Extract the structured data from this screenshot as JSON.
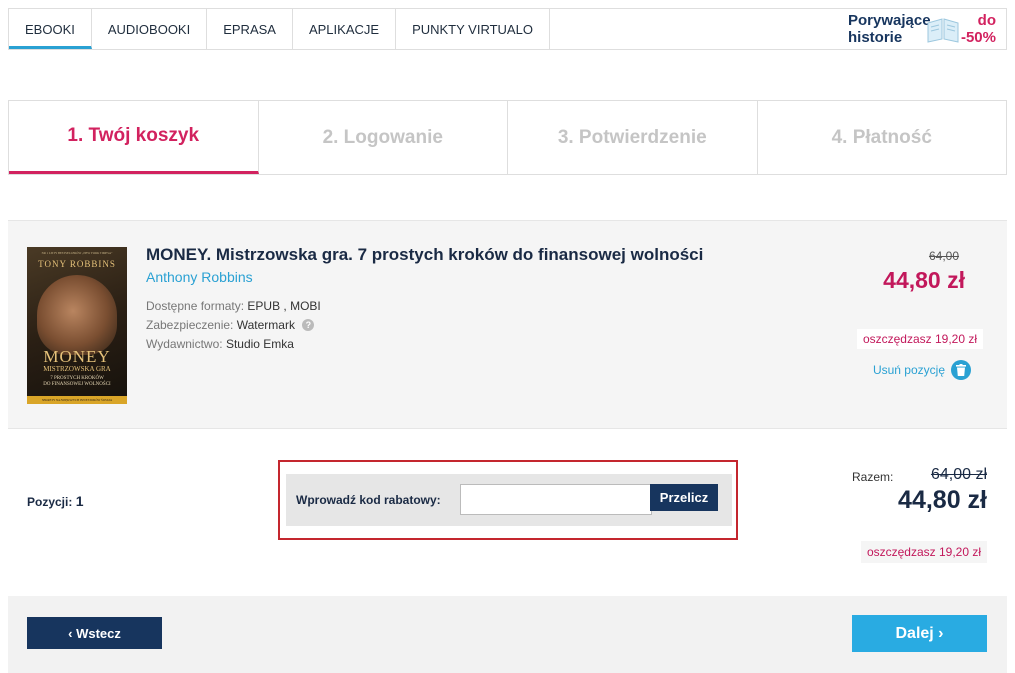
{
  "nav": {
    "tabs": [
      {
        "label": "EBOOKI"
      },
      {
        "label": "AUDIOBOOKI"
      },
      {
        "label": "EPRASA"
      },
      {
        "label": "APLIKACJE"
      },
      {
        "label": "PUNKTY VIRTUALO"
      }
    ],
    "promo": {
      "line1": "Porywające",
      "line2": "historie",
      "line3": "do",
      "line4": "-50%"
    }
  },
  "steps": [
    {
      "label": "1. Twój koszyk"
    },
    {
      "label": "2. Logowanie"
    },
    {
      "label": "3. Potwierdzenie"
    },
    {
      "label": "4. Płatność"
    }
  ],
  "item": {
    "title": "MONEY. Mistrzowska gra. 7 prostych kroków do finansowej wolności",
    "author": "Anthony Robbins",
    "formats_label": "Dostępne formaty:",
    "formats_value": "EPUB , MOBI",
    "protection_label": "Zabezpieczenie:",
    "protection_value": "Watermark",
    "publisher_label": "Wydawnictwo:",
    "publisher_value": "Studio Emka",
    "old_price": "64,00",
    "price": "44,80 zł",
    "savings": "oszczędzasz 19,20 zł",
    "remove_label": "Usuń pozycję",
    "cover": {
      "top": "NR 1 LISTY BESTSELLERÓW „NEW YORK TIMESA\"",
      "name": "TONY ROBBINS",
      "title": "MONEY",
      "subtitle": "MISTRZOWSKA GRA",
      "line1": "7 PROSTYCH KROKÓW",
      "line2": "DO FINANSOWEJ WOLNOŚCI",
      "bottom": "SEKRETY NAJWIĘKSZYCH INWESTORÓW ŚWIATA"
    }
  },
  "summary": {
    "positions_label": "Pozycji:",
    "positions_count": "1",
    "coupon_label": "Wprowadź kod rabatowy:",
    "coupon_value": "",
    "coupon_button": "Przelicz",
    "total_label": "Razem:",
    "total_old": "64,00 zł",
    "total": "44,80 zł",
    "savings": "oszczędzasz 19,20 zł"
  },
  "footer": {
    "back_label": "‹ Wstecz",
    "next_label": "Dalej ›"
  },
  "colors": {
    "accent": "#d2225f",
    "navy": "#17355e",
    "blue": "#29abe2",
    "highlight": "#c4262e"
  }
}
